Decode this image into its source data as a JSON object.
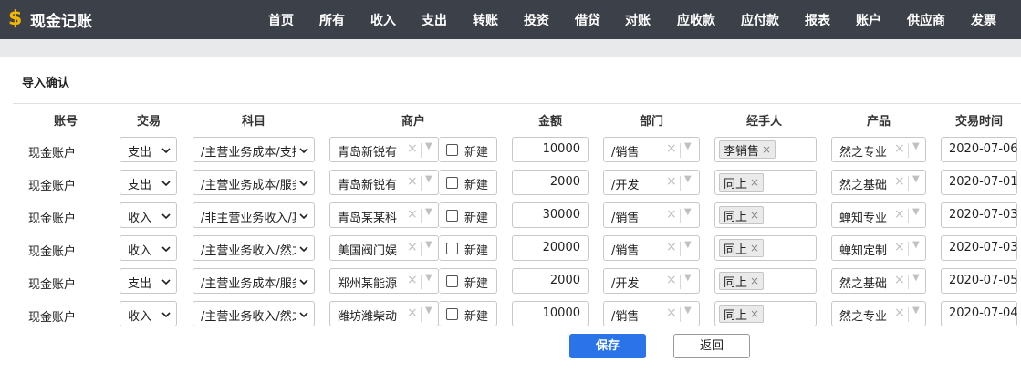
{
  "app": {
    "logo_icon": "$",
    "title": "现金记账"
  },
  "nav": {
    "items": [
      "首页",
      "所有",
      "收入",
      "支出",
      "转账",
      "投资",
      "借贷",
      "对账",
      "应收款",
      "应付款",
      "报表",
      "账户",
      "供应商",
      "发票"
    ]
  },
  "section": {
    "title": "导入确认"
  },
  "table": {
    "headers": [
      "账号",
      "交易",
      "科目",
      "商户",
      "金额",
      "部门",
      "经手人",
      "产品",
      "交易时间"
    ],
    "new_label": "新建",
    "rows": [
      {
        "account": "现金账户",
        "trade": "支出",
        "subject": "/主营业务成本/支持",
        "merchant": "青岛新锐有",
        "amount": "10000",
        "dept": "/销售",
        "handler": "李销售",
        "product": "然之专业",
        "time": "2020-07-06"
      },
      {
        "account": "现金账户",
        "trade": "支出",
        "subject": "/主营业务成本/服务",
        "merchant": "青岛新锐有",
        "amount": "2000",
        "dept": "/开发",
        "handler": "同上",
        "product": "然之基础",
        "time": "2020-07-01"
      },
      {
        "account": "现金账户",
        "trade": "收入",
        "subject": "/非主营业务收入/其",
        "merchant": "青岛某某科",
        "amount": "30000",
        "dept": "/销售",
        "handler": "同上",
        "product": "蝉知专业",
        "time": "2020-07-03"
      },
      {
        "account": "现金账户",
        "trade": "收入",
        "subject": "/主营业务收入/然之",
        "merchant": "美国阀门娱",
        "amount": "20000",
        "dept": "/销售",
        "handler": "同上",
        "product": "蝉知定制",
        "time": "2020-07-03"
      },
      {
        "account": "现金账户",
        "trade": "支出",
        "subject": "/主营业务成本/服务",
        "merchant": "郑州某能源",
        "amount": "2000",
        "dept": "/开发",
        "handler": "同上",
        "product": "然之基础",
        "time": "2020-07-05"
      },
      {
        "account": "现金账户",
        "trade": "收入",
        "subject": "/主营业务收入/然之",
        "merchant": "潍坊潍柴动",
        "amount": "10000",
        "dept": "/销售",
        "handler": "同上",
        "product": "然之专业",
        "time": "2020-07-04"
      }
    ]
  },
  "actions": {
    "save": "保存",
    "back": "返回"
  },
  "colors": {
    "nav_bg": "#3c4048",
    "logo": "#f5b800",
    "primary": "#2a73e8"
  }
}
